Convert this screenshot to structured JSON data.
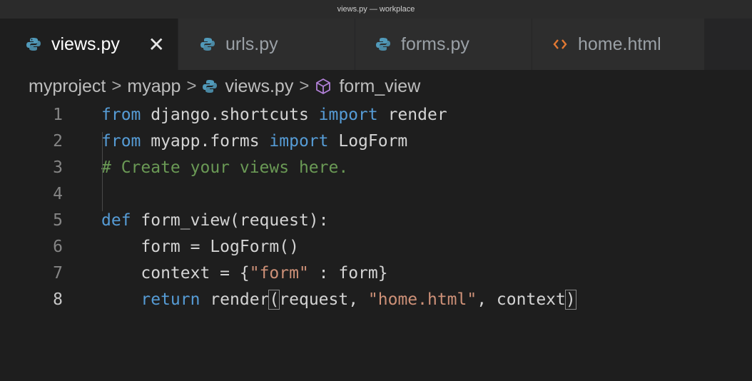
{
  "window": {
    "title": "views.py — workplace"
  },
  "tabs": [
    {
      "label": "views.py",
      "icon": "python-icon",
      "active": true,
      "close": "✕"
    },
    {
      "label": "urls.py",
      "icon": "python-icon",
      "active": false
    },
    {
      "label": "forms.py",
      "icon": "python-icon",
      "active": false
    },
    {
      "label": "home.html",
      "icon": "html-icon",
      "active": false
    }
  ],
  "breadcrumb": {
    "items": [
      "myproject",
      "myapp",
      "views.py",
      "form_view"
    ],
    "separator": ">"
  },
  "editor": {
    "current_line": 8,
    "lines": [
      {
        "num": "1",
        "tokens": [
          [
            "kw",
            "from"
          ],
          [
            "plain",
            " django.shortcuts "
          ],
          [
            "kw",
            "import"
          ],
          [
            "plain",
            " render"
          ]
        ]
      },
      {
        "num": "2",
        "tokens": [
          [
            "kw",
            "from"
          ],
          [
            "plain",
            " myapp.forms "
          ],
          [
            "kw",
            "import"
          ],
          [
            "plain",
            " LogForm"
          ]
        ]
      },
      {
        "num": "3",
        "tokens": [
          [
            "cmt",
            "# Create your views here."
          ]
        ]
      },
      {
        "num": "4",
        "tokens": []
      },
      {
        "num": "5",
        "tokens": [
          [
            "kw",
            "def"
          ],
          [
            "plain",
            " form_view(request):"
          ]
        ]
      },
      {
        "num": "6",
        "tokens": [
          [
            "plain",
            "    form = LogForm()"
          ]
        ]
      },
      {
        "num": "7",
        "tokens": [
          [
            "plain",
            "    context = {"
          ],
          [
            "str",
            "\"form\""
          ],
          [
            "plain",
            " : form}"
          ]
        ]
      },
      {
        "num": "8",
        "tokens": [
          [
            "plain",
            "    "
          ],
          [
            "kw",
            "return"
          ],
          [
            "plain",
            " render"
          ],
          [
            "box",
            "("
          ],
          [
            "plain",
            "request, "
          ],
          [
            "str",
            "\"home.html\""
          ],
          [
            "plain",
            ", context"
          ],
          [
            "box",
            ")"
          ]
        ]
      }
    ]
  },
  "colors": {
    "keyword": "#569cd6",
    "string": "#ce9178",
    "comment": "#6a9955",
    "python_icon": "#519aba",
    "html_icon": "#e37933",
    "symbol_icon": "#b180d7"
  }
}
